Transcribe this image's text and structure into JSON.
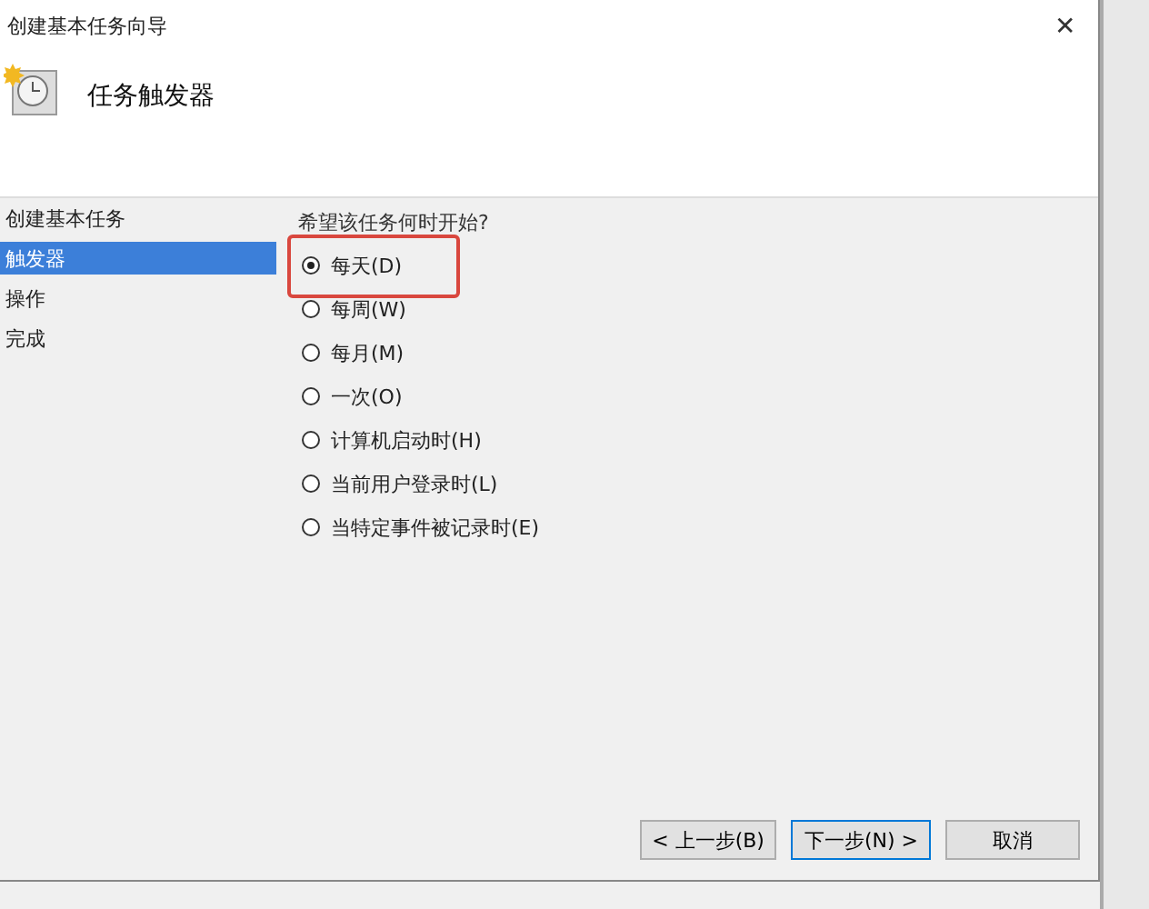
{
  "window": {
    "title": "创建基本任务向导",
    "close": "✕"
  },
  "header": {
    "title": "任务触发器"
  },
  "sidebar": {
    "items": [
      {
        "label": "创建基本任务",
        "selected": false
      },
      {
        "label": "触发器",
        "selected": true
      },
      {
        "label": "操作",
        "selected": false
      },
      {
        "label": "完成",
        "selected": false
      }
    ]
  },
  "question": "希望该任务何时开始?",
  "options": [
    {
      "label": "每天(D)",
      "selected": true,
      "highlighted": true
    },
    {
      "label": "每周(W)",
      "selected": false,
      "highlighted": false
    },
    {
      "label": "每月(M)",
      "selected": false,
      "highlighted": false
    },
    {
      "label": "一次(O)",
      "selected": false,
      "highlighted": false
    },
    {
      "label": "计算机启动时(H)",
      "selected": false,
      "highlighted": false
    },
    {
      "label": "当前用户登录时(L)",
      "selected": false,
      "highlighted": false
    },
    {
      "label": "当特定事件被记录时(E)",
      "selected": false,
      "highlighted": false
    }
  ],
  "buttons": [
    {
      "label": "< 上一步(B)",
      "kind": "normal"
    },
    {
      "label": "下一步(N) >",
      "kind": "default"
    },
    {
      "label": "取消",
      "kind": "normal"
    }
  ]
}
